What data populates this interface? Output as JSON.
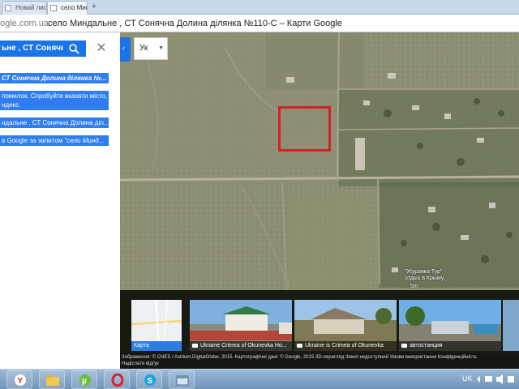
{
  "browser": {
    "tabs": [
      {
        "label": "Новий лист — Яндекс",
        "active": false
      },
      {
        "label": "село Миндальне , СТ Сонячна Долина ділянка №110-С – Карти Google",
        "active": true
      }
    ],
    "new_tab_label": "+",
    "address_domain": "ogle.com.ua",
    "page_title": "село Миндальне , СТ Сонячна Долина ділянка №110-С – Карти Google"
  },
  "search": {
    "query": "ьне , СТ Сонячна"
  },
  "results": [
    {
      "line1_bold": "СТ Сонячна Долина ділянка №..."
    },
    {
      "line1": "помилок. Спробуйте вказати місто,",
      "line2": "ндекс."
    },
    {
      "line1": "ндальне , СТ Сонячна Долина діл..."
    },
    {
      "line1_pre": "в Google за запитом \"",
      "line1_italic": "село Минд..."
    }
  ],
  "language_select": {
    "value": "Ук"
  },
  "map": {
    "label_line1": "\"Журавка Тур\"",
    "label_line2": "отдых в Крыму",
    "scale_text": "5m"
  },
  "photos": [
    {
      "caption": "Карта",
      "kind": "map"
    },
    {
      "caption": "Ukraine Crimea of Okunevka Ho...",
      "kind": "photo"
    },
    {
      "caption": "Ukraine is Crimea of Okunevka",
      "kind": "photo"
    },
    {
      "caption": "автостанция",
      "kind": "photo"
    }
  ],
  "attribution": {
    "row1": "Зображення: © CNES / Astrium,DigitalGlobe, 2015. Картографічні дані: © Google, 2015   3D-перегляд Землі недоступний   Умови використання   Конфіденційність",
    "row2": "Надіслати відгук"
  },
  "taskbar": {
    "lang": "UK",
    "apps": [
      "yandex-icon",
      "folder-icon",
      "utorrent-icon",
      "opera-icon",
      "skype-icon",
      "window-icon"
    ]
  },
  "colors": {
    "accent": "#1b73e8",
    "highlight": "#d2212a"
  }
}
